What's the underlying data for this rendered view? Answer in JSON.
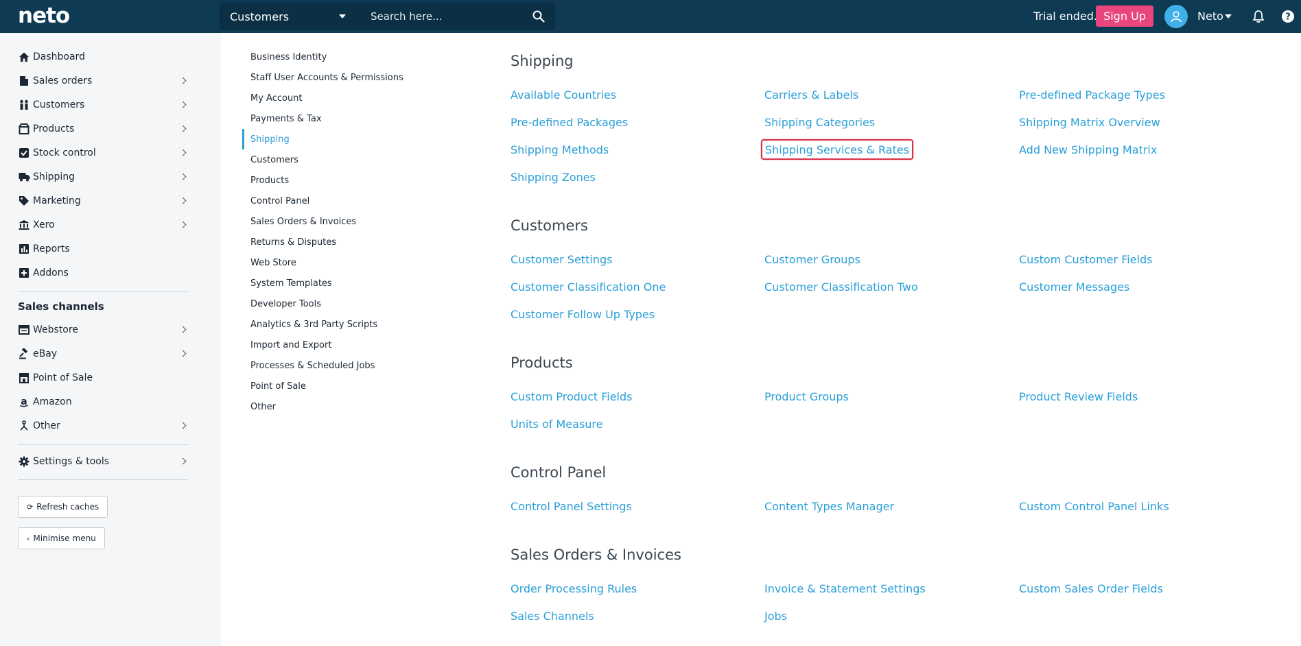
{
  "topbar": {
    "logo": "neto",
    "search_scope": "Customers",
    "search_placeholder": "Search here...",
    "trial_text": "Trial ended.",
    "signup_label": "Sign Up",
    "user_name": "Neto",
    "brand_color": "#0e3a53",
    "signup_color": "#e8467c"
  },
  "sidebar": {
    "items": [
      {
        "label": "Dashboard",
        "icon": "home-icon"
      },
      {
        "label": "Sales orders",
        "icon": "document-icon"
      },
      {
        "label": "Customers",
        "icon": "people-icon"
      },
      {
        "label": "Products",
        "icon": "box-icon"
      },
      {
        "label": "Stock control",
        "icon": "checkbox-icon"
      },
      {
        "label": "Shipping",
        "icon": "truck-icon"
      },
      {
        "label": "Marketing",
        "icon": "tag-icon"
      },
      {
        "label": "Xero",
        "icon": "bank-icon"
      },
      {
        "label": "Reports",
        "icon": "chart-icon"
      },
      {
        "label": "Addons",
        "icon": "plus-icon"
      }
    ],
    "channels_heading": "Sales channels",
    "channels": [
      {
        "label": "Webstore",
        "icon": "window-icon"
      },
      {
        "label": "eBay",
        "icon": "gavel-icon"
      },
      {
        "label": "Point of Sale",
        "icon": "store-icon"
      },
      {
        "label": "Amazon",
        "icon": "amazon-icon"
      },
      {
        "label": "Other",
        "icon": "fork-icon"
      }
    ],
    "settings_label": "Settings & tools",
    "refresh_label": "Refresh caches",
    "minimise_label": "Minimise menu"
  },
  "subnav": [
    "Business Identity",
    "Staff User Accounts & Permissions",
    "My Account",
    "Payments & Tax",
    "Shipping",
    "Customers",
    "Products",
    "Control Panel",
    "Sales Orders & Invoices",
    "Returns & Disputes",
    "Web Store",
    "System Templates",
    "Developer Tools",
    "Analytics & 3rd Party Scripts",
    "Import and Export",
    "Processes & Scheduled Jobs",
    "Point of Sale",
    "Other"
  ],
  "subnav_active": "Shipping",
  "sections": [
    {
      "title": "Shipping",
      "links": [
        "Available Countries",
        "Carriers & Labels",
        "Pre-defined Package Types",
        "Pre-defined Packages",
        "Shipping Categories",
        "Shipping Matrix Overview",
        "Shipping Methods",
        "Shipping Services & Rates",
        "Add New Shipping Matrix",
        "Shipping Zones"
      ]
    },
    {
      "title": "Customers",
      "links": [
        "Customer Settings",
        "Customer Groups",
        "Custom Customer Fields",
        "Customer Classification One",
        "Customer Classification Two",
        "Customer Messages",
        "Customer Follow Up Types"
      ]
    },
    {
      "title": "Products",
      "links": [
        "Custom Product Fields",
        "Product Groups",
        "Product Review Fields",
        "Units of Measure"
      ]
    },
    {
      "title": "Control Panel",
      "links": [
        "Control Panel Settings",
        "Content Types Manager",
        "Custom Control Panel Links"
      ]
    },
    {
      "title": "Sales Orders & Invoices",
      "links": [
        "Order Processing Rules",
        "Invoice & Statement Settings",
        "Custom Sales Order Fields",
        "Sales Channels",
        "Jobs"
      ]
    }
  ],
  "highlighted_link": "Shipping Services & Rates",
  "link_color": "#2a9fd8"
}
